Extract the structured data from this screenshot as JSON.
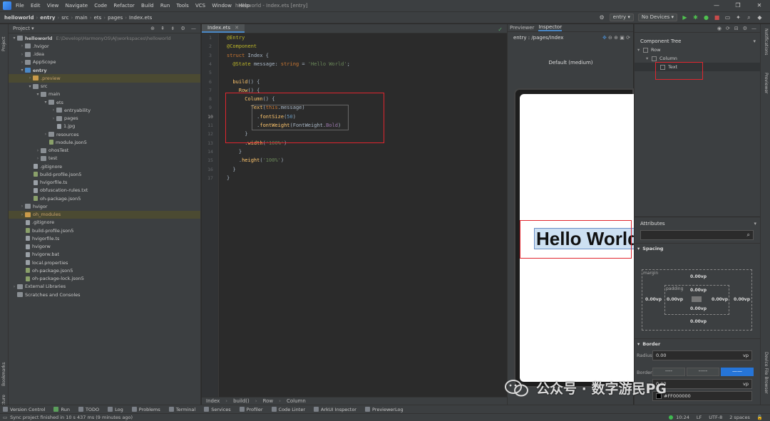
{
  "titlebar": {
    "menu": [
      "File",
      "Edit",
      "View",
      "Navigate",
      "Code",
      "Refactor",
      "Build",
      "Run",
      "Tools",
      "VCS",
      "Window",
      "Help"
    ],
    "window_title": "helloworld - Index.ets [entry]",
    "controls": [
      "—",
      "❐",
      "✕"
    ]
  },
  "navbar": {
    "crumbs": [
      "helloworld",
      "entry",
      "src",
      "main",
      "ets",
      "pages",
      "Index.ets"
    ],
    "module_select": "entry",
    "device_select": "No Devices"
  },
  "left_strip": {
    "project_label": "Project",
    "bookmarks_label": "Bookmarks",
    "structure_label": "Structure"
  },
  "project": {
    "title": "Project",
    "tree": [
      {
        "label": "helloworld",
        "path": "E:\\Develop\\HarmonyOS\\AJ\\workspaces\\helloworld",
        "level": 0,
        "arrow": "▾",
        "icon": "folder",
        "bold": true
      },
      {
        "label": ".hvigor",
        "level": 1,
        "arrow": "›",
        "icon": "folder"
      },
      {
        "label": ".idea",
        "level": 1,
        "arrow": "›",
        "icon": "folder"
      },
      {
        "label": "AppScope",
        "level": 1,
        "arrow": "›",
        "icon": "folder"
      },
      {
        "label": "entry",
        "level": 1,
        "arrow": "▾",
        "icon": "folder blue",
        "bold": true
      },
      {
        "label": ".preview",
        "level": 2,
        "arrow": "›",
        "icon": "folder orange",
        "style": "mod orange"
      },
      {
        "label": "src",
        "level": 2,
        "arrow": "▾",
        "icon": "folder"
      },
      {
        "label": "main",
        "level": 3,
        "arrow": "▾",
        "icon": "folder"
      },
      {
        "label": "ets",
        "level": 4,
        "arrow": "▾",
        "icon": "folder"
      },
      {
        "label": "entryability",
        "level": 5,
        "arrow": "›",
        "icon": "folder"
      },
      {
        "label": "pages",
        "level": 5,
        "arrow": "›",
        "icon": "folder"
      },
      {
        "label": "1.jpg",
        "level": 5,
        "arrow": "",
        "icon": "file"
      },
      {
        "label": "resources",
        "level": 4,
        "arrow": "›",
        "icon": "folder"
      },
      {
        "label": "module.json5",
        "level": 4,
        "arrow": "",
        "icon": "json"
      },
      {
        "label": "ohosTest",
        "level": 3,
        "arrow": "›",
        "icon": "folder"
      },
      {
        "label": "test",
        "level": 3,
        "arrow": "›",
        "icon": "folder"
      },
      {
        "label": ".gitignore",
        "level": 2,
        "arrow": "",
        "icon": "file"
      },
      {
        "label": "build-profile.json5",
        "level": 2,
        "arrow": "",
        "icon": "json"
      },
      {
        "label": "hvigorfile.ts",
        "level": 2,
        "arrow": "",
        "icon": "file"
      },
      {
        "label": "obfuscation-rules.txt",
        "level": 2,
        "arrow": "",
        "icon": "file"
      },
      {
        "label": "oh-package.json5",
        "level": 2,
        "arrow": "",
        "icon": "json"
      },
      {
        "label": "hvigor",
        "level": 1,
        "arrow": "›",
        "icon": "folder"
      },
      {
        "label": "oh_modules",
        "level": 1,
        "arrow": "›",
        "icon": "folder orange",
        "style": "mod orange"
      },
      {
        "label": ".gitignore",
        "level": 1,
        "arrow": "",
        "icon": "file"
      },
      {
        "label": "build-profile.json5",
        "level": 1,
        "arrow": "",
        "icon": "json"
      },
      {
        "label": "hvigorfile.ts",
        "level": 1,
        "arrow": "",
        "icon": "file"
      },
      {
        "label": "hvigorw",
        "level": 1,
        "arrow": "",
        "icon": "file"
      },
      {
        "label": "hvigorw.bat",
        "level": 1,
        "arrow": "",
        "icon": "file"
      },
      {
        "label": "local.properties",
        "level": 1,
        "arrow": "",
        "icon": "file"
      },
      {
        "label": "oh-package.json5",
        "level": 1,
        "arrow": "",
        "icon": "json"
      },
      {
        "label": "oh-package-lock.json5",
        "level": 1,
        "arrow": "",
        "icon": "json"
      },
      {
        "label": "External Libraries",
        "level": 0,
        "arrow": "›",
        "icon": "folder"
      },
      {
        "label": "Scratches and Consoles",
        "level": 0,
        "arrow": "",
        "icon": "folder"
      }
    ]
  },
  "editor": {
    "tab": "Index.ets",
    "lines": [
      [
        [
          "ann",
          "@Entry"
        ]
      ],
      [
        [
          "ann",
          "@Component"
        ]
      ],
      [
        [
          "kw",
          "struct "
        ],
        [
          "cls",
          "Index {"
        ]
      ],
      [
        [
          "ann",
          "  @State "
        ],
        [
          "cls",
          "message: "
        ],
        [
          "kw",
          "string"
        ],
        [
          "cls",
          " = "
        ],
        [
          "str",
          "'Hello World'"
        ],
        [
          "cls",
          ";"
        ]
      ],
      [
        [
          "cls",
          ""
        ]
      ],
      [
        [
          "fn",
          "  build"
        ],
        [
          "cls",
          "() {"
        ]
      ],
      [
        [
          "fn",
          "    Row"
        ],
        [
          "cls",
          "() {"
        ]
      ],
      [
        [
          "fn",
          "      Column"
        ],
        [
          "cls",
          "() {"
        ]
      ],
      [
        [
          "fn",
          "        Text"
        ],
        [
          "cls",
          "("
        ],
        [
          "kw",
          "this"
        ],
        [
          "cls",
          ".message)"
        ]
      ],
      [
        [
          "cls",
          "          ."
        ],
        [
          "fn",
          "fontSize"
        ],
        [
          "cls",
          "("
        ],
        [
          "num",
          "50"
        ],
        [
          "cls",
          ")"
        ]
      ],
      [
        [
          "cls",
          "          ."
        ],
        [
          "fn",
          "fontWeight"
        ],
        [
          "cls",
          "(FontWeight."
        ],
        [
          "prop",
          "Bold"
        ],
        [
          "cls",
          ")"
        ]
      ],
      [
        [
          "cls",
          "      }"
        ]
      ],
      [
        [
          "cls",
          "      ."
        ],
        [
          "fn",
          "width"
        ],
        [
          "cls",
          "("
        ],
        [
          "str",
          "'100%'"
        ],
        [
          "cls",
          ")"
        ]
      ],
      [
        [
          "cls",
          "    }"
        ]
      ],
      [
        [
          "cls",
          "    ."
        ],
        [
          "fn",
          "height"
        ],
        [
          "cls",
          "("
        ],
        [
          "str",
          "'100%'"
        ],
        [
          "cls",
          ")"
        ]
      ],
      [
        [
          "cls",
          "  }"
        ]
      ],
      [
        [
          "cls",
          "}"
        ]
      ]
    ],
    "line_numbers": [
      "1",
      "2",
      "3",
      "4",
      "5",
      "6",
      "7",
      "8",
      "9",
      "10",
      "11",
      "12",
      "13",
      "14",
      "15",
      "16",
      "17"
    ],
    "current_line": 10,
    "breadcrumb": [
      "Index",
      "build()",
      "Row",
      "Column"
    ]
  },
  "preview": {
    "tabs": [
      "Previewer",
      "Inspector"
    ],
    "route": "entry : /pages/Index",
    "device": "Default (medium)",
    "rendered_text": "Hello World"
  },
  "component_tree": {
    "title": "Component Tree",
    "nodes": [
      {
        "label": "Row",
        "level": 0,
        "arrow": "▾"
      },
      {
        "label": "Column",
        "level": 1,
        "arrow": "▾"
      },
      {
        "label": "Text",
        "level": 2,
        "arrow": ""
      }
    ]
  },
  "attributes": {
    "title": "Attributes",
    "spacing_title": "Spacing",
    "margin_label": "margin",
    "padding_label": "padding",
    "margin": {
      "top": "0.00vp",
      "left": "0.00vp",
      "right": "0.00vp",
      "bottom": "0.00vp"
    },
    "padding": {
      "top": "0.00vp",
      "left": "0.00vp",
      "right": "0.00vp",
      "bottom": "0.00vp"
    },
    "border_title": "Border",
    "radius_label": "Radius",
    "radius_value": "0.00",
    "radius_unit": "vp",
    "border_label": "Border",
    "border_style_buttons": [
      "----",
      "-----",
      "——"
    ],
    "width_value": "0.00",
    "width_unit": "vp",
    "color_value": "#FF000000"
  },
  "right_strip": {
    "notifications": "Notifications",
    "previewer": "Previewer",
    "device_file_browser": "Device File Browser"
  },
  "toolbar": [
    "Version Control",
    "Run",
    "TODO",
    "Log",
    "Problems",
    "Terminal",
    "Services",
    "Profiler",
    "Code Linter",
    "ArkUI Inspector",
    "PreviewerLog"
  ],
  "statusbar": {
    "message": "Sync project finished in 10 s 437 ms (9 minutes ago)",
    "position": "10:24",
    "line_sep": "LF",
    "encoding": "UTF-8",
    "indent": "2 spaces"
  },
  "watermark": "公众号 · 数字游民PG",
  "colors": {
    "accent": "#4a88c7",
    "highlight_box": "#e0262f",
    "selected_button": "#2675d8"
  }
}
